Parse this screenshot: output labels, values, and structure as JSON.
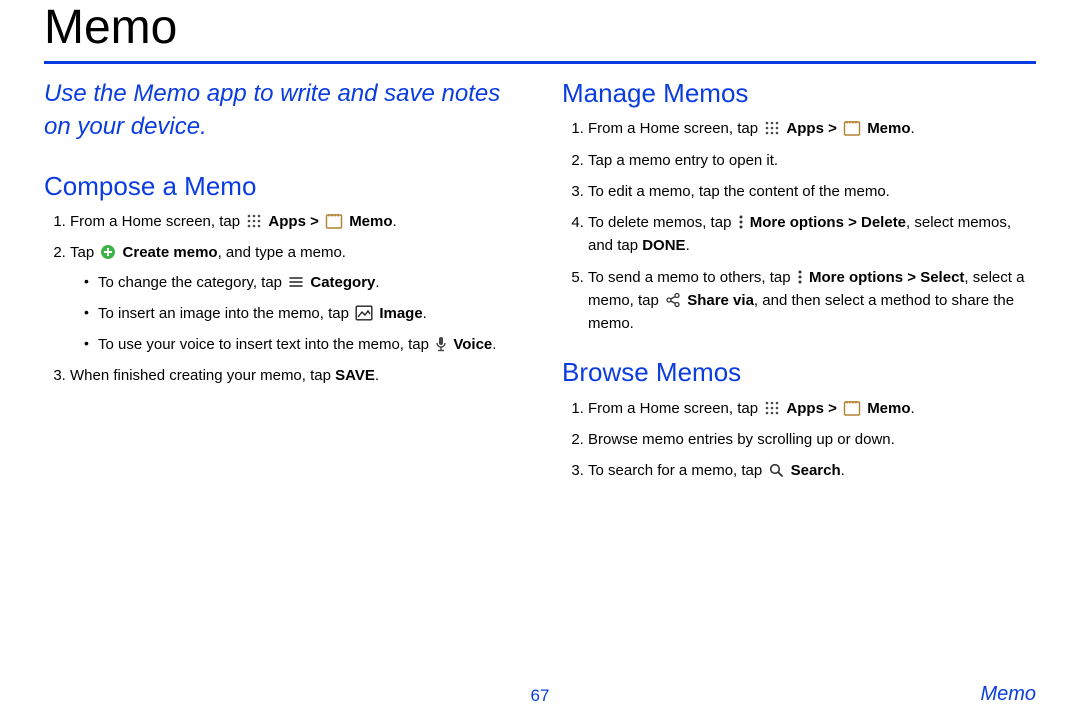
{
  "title": "Memo",
  "intro": "Use the Memo app to write and save notes on your device.",
  "compose": {
    "heading": "Compose a Memo",
    "s1a": "From a Home screen, tap ",
    "s1_apps": "Apps",
    "gt": ">",
    "s1_memo": "Memo",
    "period": ".",
    "s2a": "Tap ",
    "s2b": "Create memo",
    "s2c": ", and type a memo.",
    "b1a": "To change the category, tap ",
    "b1b": "Category",
    "b2a": "To insert an image into the memo, tap ",
    "b2b": "Image",
    "b3a": "To use your voice to insert text into the memo, tap ",
    "b3b": "Voice",
    "s3a": "When finished creating your memo, tap ",
    "s3b": "SAVE"
  },
  "manage": {
    "heading": "Manage Memos",
    "s2": "Tap a memo entry to open it.",
    "s3": "To edit a memo, tap the content of the memo.",
    "s4a": "To delete memos, tap ",
    "s4b": "More options > Delete",
    "s4c": ", select memos, and tap ",
    "s4d": "DONE",
    "s5a": "To send a memo to others, tap ",
    "s5b": "More options > Select",
    "s5c": ", select a memo, tap ",
    "s5d": "Share via",
    "s5e": ", and then select a method to share the memo."
  },
  "browse": {
    "heading": "Browse Memos",
    "s2": "Browse memo entries by scrolling up or down.",
    "s3a": "To search for a memo, tap ",
    "s3b": "Search"
  },
  "footer": {
    "page": "67",
    "label": "Memo"
  }
}
